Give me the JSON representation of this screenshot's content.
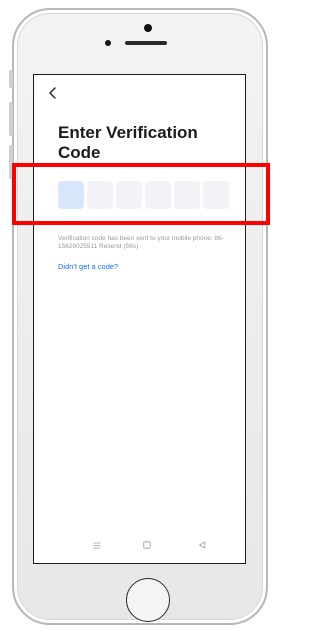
{
  "screen": {
    "title": "Enter Verification Code",
    "code_boxes": [
      {
        "value": "",
        "active": true
      },
      {
        "value": "",
        "active": false
      },
      {
        "value": "",
        "active": false
      },
      {
        "value": "",
        "active": false
      },
      {
        "value": "",
        "active": false
      },
      {
        "value": "",
        "active": false
      }
    ],
    "info_text": "Verification code has been sent to your mobile phone: 86-15626025511",
    "resend_label": "Resend (56s)",
    "no_code_link": "Didn't get a code?"
  },
  "icons": {
    "back": "chevron-left-icon",
    "nav_menu": "menu-icon",
    "nav_home": "square-icon",
    "nav_back": "triangle-back-icon"
  },
  "colors": {
    "title": "#1b1b1b",
    "active_box": "#d6e6fb",
    "box": "#f1f3f7",
    "link": "#1a73e8",
    "info": "#9b9b9b",
    "highlight": "#ff0000"
  }
}
